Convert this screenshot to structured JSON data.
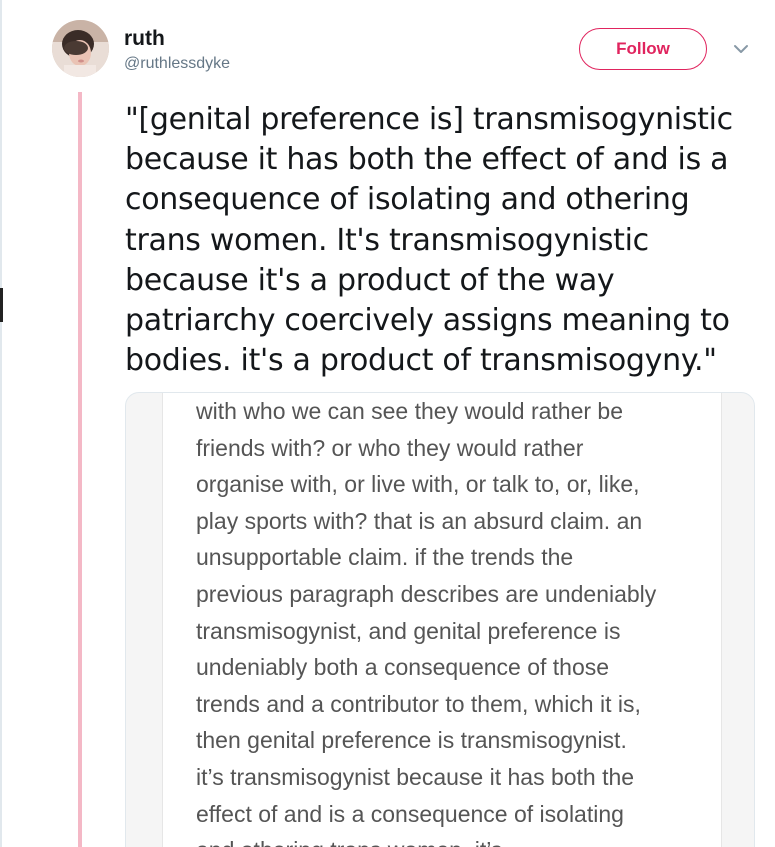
{
  "tweet": {
    "author": {
      "display_name": "ruth",
      "handle": "@ruthlessdyke"
    },
    "follow_label": "Follow",
    "text_lines": [
      "\"[genital preference is] transmisogynistic",
      "because it has both the effect of and is a",
      "consequence of isolating and othering",
      "trans women. It's transmisogynistic",
      "because it's a product of the way",
      "patriarchy coercively assigns meaning to",
      "bodies. it's a product of transmisogyny.\""
    ],
    "media_text_lines": [
      "with who we can see they would rather be",
      "friends with? or who they would rather",
      "organise with, or live with, or talk to, or, like,",
      "play sports with? that is an absurd claim. an",
      "unsupportable claim. if the trends the",
      "previous paragraph describes are undeniably",
      "transmisogynist, and genital preference is",
      "undeniably both a consequence of those",
      "trends and a contributor to them, which it is,",
      "then genital preference is transmisogynist.",
      "it’s transmisogynist because it has both the",
      "effect of and is a consequence of isolating",
      "and othering trans women. it’s"
    ]
  },
  "icons": {
    "avatar": "user-avatar-photo",
    "caret": "chevron-down-icon"
  },
  "colors": {
    "follow_accent": "#e0245e",
    "thread_line": "#f4b8c6",
    "handle_gray": "#657786"
  }
}
